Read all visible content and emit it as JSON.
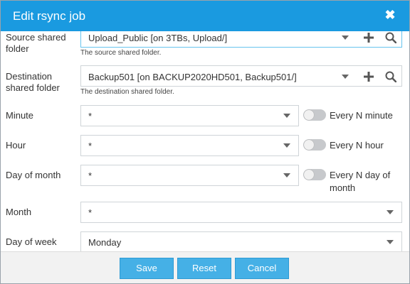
{
  "dialog": {
    "title": "Edit rsync job",
    "close_label": "✖"
  },
  "source": {
    "label": "Source shared folder",
    "value": "Upload_Public [on 3TBs, Upload/]",
    "hint": "The source shared folder."
  },
  "destination": {
    "label": "Destination shared folder",
    "value": "Backup501 [on BACKUP2020HD501, Backup501/]",
    "hint": "The destination shared folder."
  },
  "minute": {
    "label": "Minute",
    "value": "*",
    "toggle_label": "Every N minute"
  },
  "hour": {
    "label": "Hour",
    "value": "*",
    "toggle_label": "Every N hour"
  },
  "day_of_month": {
    "label": "Day of month",
    "value": "*",
    "toggle_label": "Every N day of month"
  },
  "month": {
    "label": "Month",
    "value": "*"
  },
  "day_of_week": {
    "label": "Day of week",
    "value": "Monday"
  },
  "footer": {
    "save_label": "Save",
    "reset_label": "Reset",
    "cancel_label": "Cancel"
  }
}
